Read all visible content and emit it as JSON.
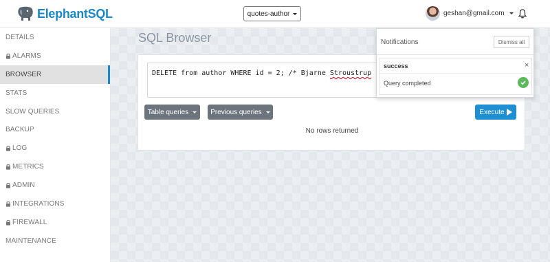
{
  "header": {
    "brand_name": "ElephantSQL",
    "instance_label": "quotes-author",
    "user_email": "geshan@gmail.com"
  },
  "sidebar": {
    "items": [
      {
        "label": "DETAILS",
        "locked": false,
        "active": false
      },
      {
        "label": "ALARMS",
        "locked": true,
        "active": false
      },
      {
        "label": "BROWSER",
        "locked": false,
        "active": true
      },
      {
        "label": "STATS",
        "locked": false,
        "active": false
      },
      {
        "label": "SLOW QUERIES",
        "locked": false,
        "active": false
      },
      {
        "label": "BACKUP",
        "locked": false,
        "active": false
      },
      {
        "label": "LOG",
        "locked": true,
        "active": false
      },
      {
        "label": "METRICS",
        "locked": true,
        "active": false
      },
      {
        "label": "ADMIN",
        "locked": true,
        "active": false
      },
      {
        "label": "INTEGRATIONS",
        "locked": true,
        "active": false
      },
      {
        "label": "FIREWALL",
        "locked": true,
        "active": false
      },
      {
        "label": "MAINTENANCE",
        "locked": false,
        "active": false
      }
    ]
  },
  "main": {
    "title": "SQL Browser",
    "query_part1": "DELETE from author WHERE id = 2; /* Bjarne ",
    "query_misspelled": "Stroustrup",
    "query_part2": " */",
    "table_queries_label": "Table queries",
    "previous_queries_label": "Previous queries",
    "execute_label": "Execute",
    "result_text": "No rows returned"
  },
  "notifications": {
    "title": "Notifications",
    "dismiss_label": "Dismiss all",
    "item_title": "success",
    "item_close": "×",
    "item_message": "Query completed"
  },
  "colors": {
    "brand": "#1a87c6",
    "execute": "#1f8fd3",
    "secondary": "#6c757d",
    "success": "#5cb85c"
  }
}
